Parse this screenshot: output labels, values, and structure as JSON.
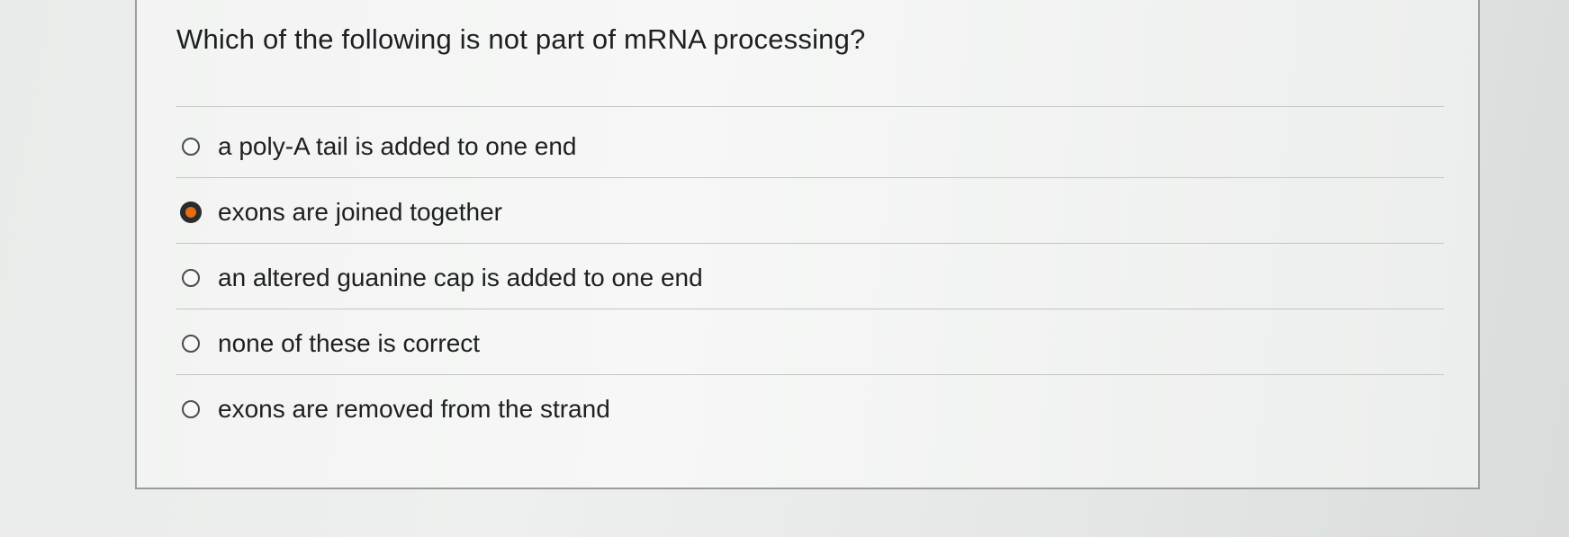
{
  "question": {
    "text": "Which of the following is not part of mRNA processing?"
  },
  "options": [
    {
      "label": "a poly-A tail is added to one end",
      "selected": false
    },
    {
      "label": "exons are joined together",
      "selected": true
    },
    {
      "label": "an altered guanine cap is added to one end",
      "selected": false
    },
    {
      "label": "none of these is correct",
      "selected": false
    },
    {
      "label": "exons are removed from the strand",
      "selected": false
    }
  ],
  "colors": {
    "selected_radio_fill": "#e26d12",
    "radio_border": "#4a4c4f",
    "text": "#1d1f22"
  }
}
